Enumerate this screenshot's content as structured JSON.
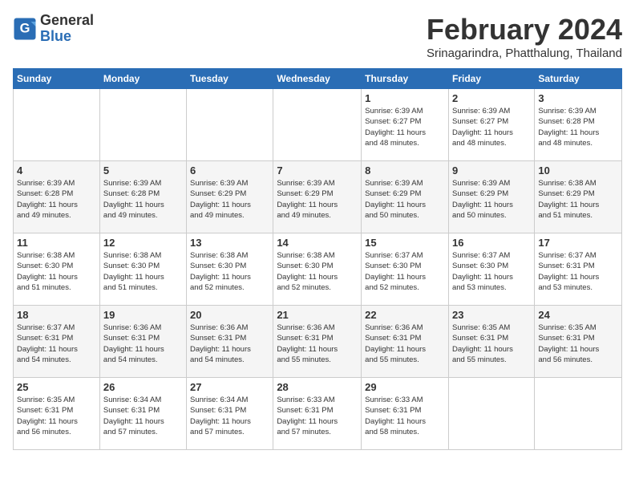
{
  "logo": {
    "line1": "General",
    "line2": "Blue"
  },
  "title": "February 2024",
  "subtitle": "Srinagarindra, Phatthalung, Thailand",
  "days_of_week": [
    "Sunday",
    "Monday",
    "Tuesday",
    "Wednesday",
    "Thursday",
    "Friday",
    "Saturday"
  ],
  "weeks": [
    [
      {
        "num": "",
        "info": ""
      },
      {
        "num": "",
        "info": ""
      },
      {
        "num": "",
        "info": ""
      },
      {
        "num": "",
        "info": ""
      },
      {
        "num": "1",
        "info": "Sunrise: 6:39 AM\nSunset: 6:27 PM\nDaylight: 11 hours\nand 48 minutes."
      },
      {
        "num": "2",
        "info": "Sunrise: 6:39 AM\nSunset: 6:27 PM\nDaylight: 11 hours\nand 48 minutes."
      },
      {
        "num": "3",
        "info": "Sunrise: 6:39 AM\nSunset: 6:28 PM\nDaylight: 11 hours\nand 48 minutes."
      }
    ],
    [
      {
        "num": "4",
        "info": "Sunrise: 6:39 AM\nSunset: 6:28 PM\nDaylight: 11 hours\nand 49 minutes."
      },
      {
        "num": "5",
        "info": "Sunrise: 6:39 AM\nSunset: 6:28 PM\nDaylight: 11 hours\nand 49 minutes."
      },
      {
        "num": "6",
        "info": "Sunrise: 6:39 AM\nSunset: 6:29 PM\nDaylight: 11 hours\nand 49 minutes."
      },
      {
        "num": "7",
        "info": "Sunrise: 6:39 AM\nSunset: 6:29 PM\nDaylight: 11 hours\nand 49 minutes."
      },
      {
        "num": "8",
        "info": "Sunrise: 6:39 AM\nSunset: 6:29 PM\nDaylight: 11 hours\nand 50 minutes."
      },
      {
        "num": "9",
        "info": "Sunrise: 6:39 AM\nSunset: 6:29 PM\nDaylight: 11 hours\nand 50 minutes."
      },
      {
        "num": "10",
        "info": "Sunrise: 6:38 AM\nSunset: 6:29 PM\nDaylight: 11 hours\nand 51 minutes."
      }
    ],
    [
      {
        "num": "11",
        "info": "Sunrise: 6:38 AM\nSunset: 6:30 PM\nDaylight: 11 hours\nand 51 minutes."
      },
      {
        "num": "12",
        "info": "Sunrise: 6:38 AM\nSunset: 6:30 PM\nDaylight: 11 hours\nand 51 minutes."
      },
      {
        "num": "13",
        "info": "Sunrise: 6:38 AM\nSunset: 6:30 PM\nDaylight: 11 hours\nand 52 minutes."
      },
      {
        "num": "14",
        "info": "Sunrise: 6:38 AM\nSunset: 6:30 PM\nDaylight: 11 hours\nand 52 minutes."
      },
      {
        "num": "15",
        "info": "Sunrise: 6:37 AM\nSunset: 6:30 PM\nDaylight: 11 hours\nand 52 minutes."
      },
      {
        "num": "16",
        "info": "Sunrise: 6:37 AM\nSunset: 6:30 PM\nDaylight: 11 hours\nand 53 minutes."
      },
      {
        "num": "17",
        "info": "Sunrise: 6:37 AM\nSunset: 6:31 PM\nDaylight: 11 hours\nand 53 minutes."
      }
    ],
    [
      {
        "num": "18",
        "info": "Sunrise: 6:37 AM\nSunset: 6:31 PM\nDaylight: 11 hours\nand 54 minutes."
      },
      {
        "num": "19",
        "info": "Sunrise: 6:36 AM\nSunset: 6:31 PM\nDaylight: 11 hours\nand 54 minutes."
      },
      {
        "num": "20",
        "info": "Sunrise: 6:36 AM\nSunset: 6:31 PM\nDaylight: 11 hours\nand 54 minutes."
      },
      {
        "num": "21",
        "info": "Sunrise: 6:36 AM\nSunset: 6:31 PM\nDaylight: 11 hours\nand 55 minutes."
      },
      {
        "num": "22",
        "info": "Sunrise: 6:36 AM\nSunset: 6:31 PM\nDaylight: 11 hours\nand 55 minutes."
      },
      {
        "num": "23",
        "info": "Sunrise: 6:35 AM\nSunset: 6:31 PM\nDaylight: 11 hours\nand 55 minutes."
      },
      {
        "num": "24",
        "info": "Sunrise: 6:35 AM\nSunset: 6:31 PM\nDaylight: 11 hours\nand 56 minutes."
      }
    ],
    [
      {
        "num": "25",
        "info": "Sunrise: 6:35 AM\nSunset: 6:31 PM\nDaylight: 11 hours\nand 56 minutes."
      },
      {
        "num": "26",
        "info": "Sunrise: 6:34 AM\nSunset: 6:31 PM\nDaylight: 11 hours\nand 57 minutes."
      },
      {
        "num": "27",
        "info": "Sunrise: 6:34 AM\nSunset: 6:31 PM\nDaylight: 11 hours\nand 57 minutes."
      },
      {
        "num": "28",
        "info": "Sunrise: 6:33 AM\nSunset: 6:31 PM\nDaylight: 11 hours\nand 57 minutes."
      },
      {
        "num": "29",
        "info": "Sunrise: 6:33 AM\nSunset: 6:31 PM\nDaylight: 11 hours\nand 58 minutes."
      },
      {
        "num": "",
        "info": ""
      },
      {
        "num": "",
        "info": ""
      }
    ]
  ]
}
